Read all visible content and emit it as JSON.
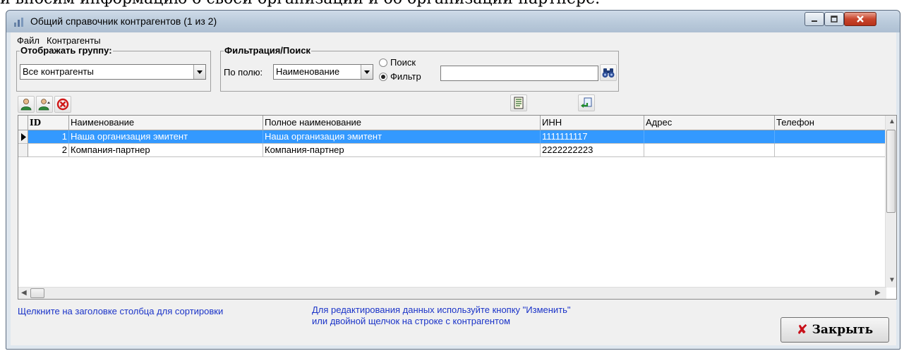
{
  "page": {
    "caption": "и вносим информацию о своей организации и об организации-партнере."
  },
  "window": {
    "title": "Общий справочник контрагентов (1 из 2)"
  },
  "menu": {
    "items": [
      "Файл",
      "Контрагенты"
    ]
  },
  "group_filter": {
    "legend": "Отображать группу:",
    "selected": "Все контрагенты"
  },
  "search_filter": {
    "legend": "Фильтрация/Поиск",
    "field_label": "По полю:",
    "field_selected": "Наименование",
    "mode_search": "Поиск",
    "mode_filter": "Фильтр",
    "active_mode": "Фильтр",
    "query": ""
  },
  "toolbar": {
    "icons": [
      "add-user-icon",
      "edit-user-icon",
      "delete-icon",
      "report-icon",
      "select-icon"
    ]
  },
  "table": {
    "columns": [
      "ID",
      "Наименование",
      "Полное наименование",
      "ИНН",
      "Адрес",
      "Телефон"
    ],
    "rows": [
      {
        "id": "1",
        "name": "Наша организация эмитент",
        "full_name": "Наша организация эмитент",
        "inn": "1111111117",
        "address": "",
        "phone": ""
      },
      {
        "id": "2",
        "name": "Компания-партнер",
        "full_name": "Компания-партнер",
        "inn": "2222222223",
        "address": "",
        "phone": ""
      }
    ],
    "selected_row": 1
  },
  "footer": {
    "sort_hint": "Щелкните на заголовке столбца для сортировки",
    "edit_hint_line1": "Для редактирования данных используйте кнопку \"Изменить\"",
    "edit_hint_line2": "или двойной щелчок на строке с контрагентом",
    "close_label": "Закрыть"
  },
  "colors": {
    "selection": "#3399ff",
    "hint_text": "#1a33c8",
    "close_icon": "#c8101a"
  }
}
